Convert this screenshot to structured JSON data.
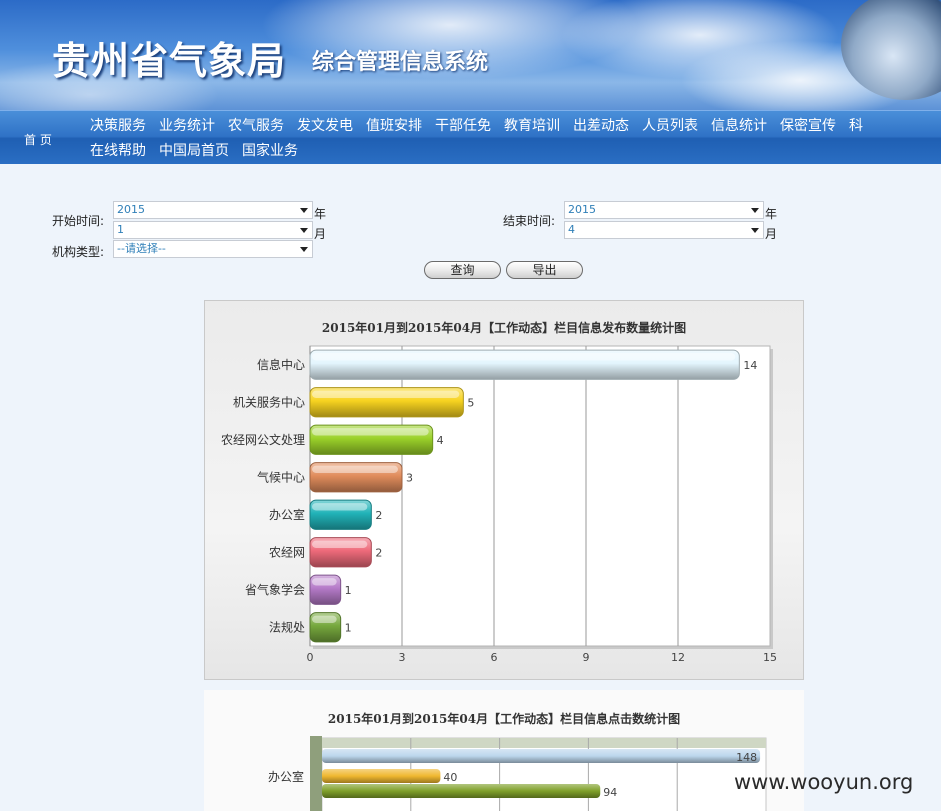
{
  "header": {
    "title": "贵州省气象局",
    "subtitle": "综合管理信息系统"
  },
  "nav": {
    "home": "首 页",
    "row1": [
      "决策服务",
      "业务统计",
      "农气服务",
      "发文发电",
      "值班安排",
      "干部任免",
      "教育培训",
      "出差动态",
      "人员列表",
      "信息统计",
      "保密宣传",
      "科"
    ],
    "row2": [
      "在线帮助",
      "中国局首页",
      "国家业务"
    ]
  },
  "form": {
    "start_label": "开始时间:",
    "end_label": "结束时间:",
    "org_label": "机构类型:",
    "start_year": "2015",
    "start_month": "1",
    "end_year": "2015",
    "end_month": "4",
    "org_value": "--请选择--",
    "unit_year": "年",
    "unit_month": "月",
    "query_button": "查询",
    "export_button": "导出"
  },
  "charts": {
    "chart1_title": "2015年01月到2015年04月【工作动态】栏目信息发布数量统计图",
    "chart2_title": "2015年01月到2015年04月【工作动态】栏目信息点击数统计图",
    "chart2_category": "办公室"
  },
  "colors": {
    "bar_palette": [
      "#e3f5fd",
      "#f7d320",
      "#9bd22a",
      "#e18c5c",
      "#21b3b8",
      "#ee6a7a",
      "#b57ac8",
      "#76a83d"
    ],
    "nav_bg": "#2f72c6"
  },
  "chart_data": [
    {
      "type": "bar",
      "orientation": "horizontal",
      "title": "2015年01月到2015年04月【工作动态】栏目信息发布数量统计图",
      "categories": [
        "信息中心",
        "机关服务中心",
        "农经网公文处理",
        "气候中心",
        "办公室",
        "农经网",
        "省气象学会",
        "法规处"
      ],
      "values": [
        14,
        5,
        4,
        3,
        2,
        2,
        1,
        1
      ],
      "xlim": [
        0,
        15
      ],
      "xticks": [
        0,
        3,
        6,
        9,
        12,
        15
      ],
      "grid": true
    },
    {
      "type": "bar",
      "orientation": "horizontal",
      "title": "2015年01月到2015年04月【工作动态】栏目信息点击数统计图",
      "categories": [
        "办公室"
      ],
      "series_values": [
        148,
        40,
        94
      ],
      "series_colors": [
        "#bcd6ec",
        "#f0b830",
        "#7fa02a"
      ],
      "grid": true
    }
  ],
  "watermark": "www.wooyun.org"
}
